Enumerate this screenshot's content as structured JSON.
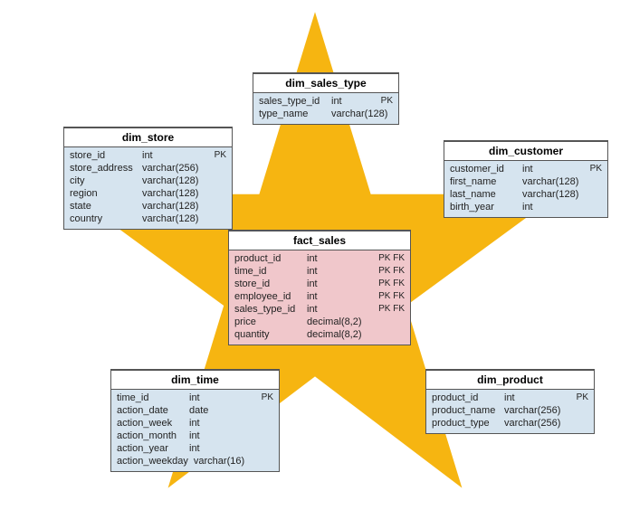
{
  "colors": {
    "star": "#f6b511",
    "dim_bg": "#d6e4ef",
    "fact_bg": "#f0c7cb"
  },
  "tables": {
    "dim_sales_type": {
      "title": "dim_sales_type",
      "cols": [
        {
          "name": "sales_type_id",
          "type": "int",
          "key": "PK"
        },
        {
          "name": "type_name",
          "type": "varchar(128)",
          "key": ""
        }
      ]
    },
    "dim_store": {
      "title": "dim_store",
      "cols": [
        {
          "name": "store_id",
          "type": "int",
          "key": "PK"
        },
        {
          "name": "store_address",
          "type": "varchar(256)",
          "key": ""
        },
        {
          "name": "city",
          "type": "varchar(128)",
          "key": ""
        },
        {
          "name": "region",
          "type": "varchar(128)",
          "key": ""
        },
        {
          "name": "state",
          "type": "varchar(128)",
          "key": ""
        },
        {
          "name": "country",
          "type": "varchar(128)",
          "key": ""
        }
      ]
    },
    "dim_customer": {
      "title": "dim_customer",
      "cols": [
        {
          "name": "customer_id",
          "type": "int",
          "key": "PK"
        },
        {
          "name": "first_name",
          "type": "varchar(128)",
          "key": ""
        },
        {
          "name": "last_name",
          "type": "varchar(128)",
          "key": ""
        },
        {
          "name": "birth_year",
          "type": "int",
          "key": ""
        }
      ]
    },
    "fact_sales": {
      "title": "fact_sales",
      "cols": [
        {
          "name": "product_id",
          "type": "int",
          "key": "PK FK"
        },
        {
          "name": "time_id",
          "type": "int",
          "key": "PK FK"
        },
        {
          "name": "store_id",
          "type": "int",
          "key": "PK FK"
        },
        {
          "name": "employee_id",
          "type": "int",
          "key": "PK FK"
        },
        {
          "name": "sales_type_id",
          "type": "int",
          "key": "PK FK"
        },
        {
          "name": "price",
          "type": "decimal(8,2)",
          "key": ""
        },
        {
          "name": "quantity",
          "type": "decimal(8,2)",
          "key": ""
        }
      ]
    },
    "dim_time": {
      "title": "dim_time",
      "cols": [
        {
          "name": "time_id",
          "type": "int",
          "key": "PK"
        },
        {
          "name": "action_date",
          "type": "date",
          "key": ""
        },
        {
          "name": "action_week",
          "type": "int",
          "key": ""
        },
        {
          "name": "action_month",
          "type": "int",
          "key": ""
        },
        {
          "name": "action_year",
          "type": "int",
          "key": ""
        },
        {
          "name": "action_weekday",
          "type": "varchar(16)",
          "key": ""
        }
      ]
    },
    "dim_product": {
      "title": "dim_product",
      "cols": [
        {
          "name": "product_id",
          "type": "int",
          "key": "PK"
        },
        {
          "name": "product_name",
          "type": "varchar(256)",
          "key": ""
        },
        {
          "name": "product_type",
          "type": "varchar(256)",
          "key": ""
        }
      ]
    }
  }
}
